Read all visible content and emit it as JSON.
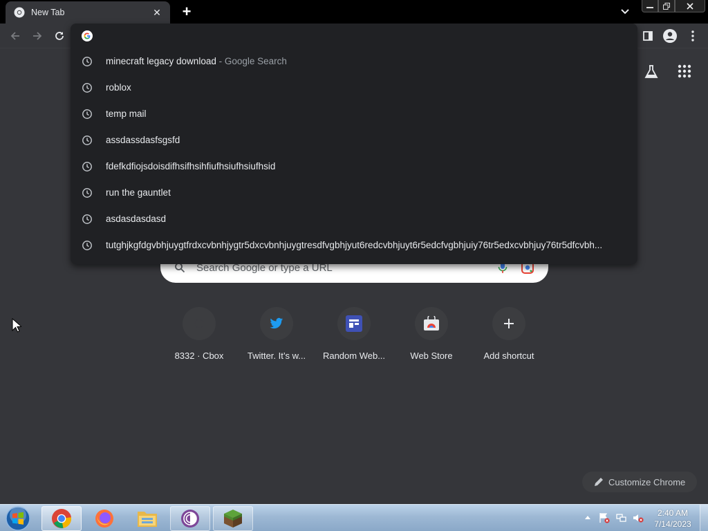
{
  "tab": {
    "title": "New Tab",
    "icon": "chrome-icon"
  },
  "window_controls": {
    "minimize": "minimize-icon",
    "maximize": "restore-icon",
    "close": "close-icon"
  },
  "toolbar": {
    "back": "back-arrow-icon",
    "forward": "forward-arrow-icon",
    "reload": "reload-icon",
    "side_panel": "side-panel-icon",
    "profile": "profile-icon",
    "menu": "more-vert-icon"
  },
  "omnibox": {
    "value": "",
    "suggestions": [
      {
        "text": "minecraft legacy download",
        "suffix": " - Google Search"
      },
      {
        "text": "roblox",
        "suffix": ""
      },
      {
        "text": "temp mail",
        "suffix": ""
      },
      {
        "text": "assdassdasfsgsfd",
        "suffix": ""
      },
      {
        "text": "fdefkdfiojsdoisdifhsifhsihfiufhsiufhsiufhsid",
        "suffix": ""
      },
      {
        "text": "run the gauntlet",
        "suffix": ""
      },
      {
        "text": "asdasdasdasd",
        "suffix": ""
      },
      {
        "text": "tutghjkgfdgvbhjuygtfrdxcvbnhjygtr5dxcvbnhjuygtresdfvgbhjyut6redcvbhjuyt6r5edcfvgbhjuiy76tr5edxcvbhjuy76tr5dfcvbh...",
        "suffix": ""
      }
    ]
  },
  "ntp": {
    "search_placeholder": "Search Google or type a URL",
    "shortcuts": [
      {
        "label": "8332 · Cbox"
      },
      {
        "label": "Twitter. It’s w..."
      },
      {
        "label": "Random Web..."
      },
      {
        "label": "Web Store"
      },
      {
        "label": "Add shortcut"
      }
    ],
    "customize_label": "Customize Chrome"
  },
  "taskbar": {
    "clock_time": "2:40 AM",
    "clock_date": "7/14/2023",
    "apps": [
      "chrome-icon",
      "firefox-icon",
      "file-explorer-icon",
      "tor-browser-icon",
      "minecraft-icon"
    ]
  },
  "colors": {
    "background": "#35363a",
    "popup": "#202124",
    "text": "#e8eaed",
    "muted": "#9aa0a6"
  }
}
